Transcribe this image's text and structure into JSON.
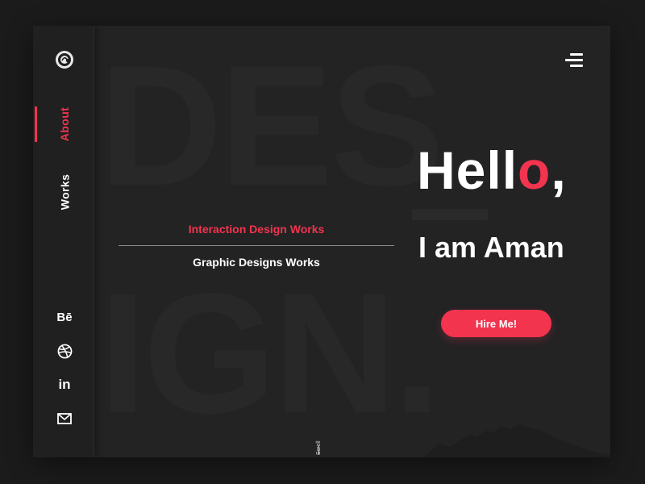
{
  "sidebar": {
    "logo_icon": "avatar-logo-icon",
    "nav": [
      {
        "label": "About",
        "active": true
      },
      {
        "label": "Works",
        "active": false
      }
    ],
    "social": [
      {
        "icon": "behance-icon",
        "label": "Bē"
      },
      {
        "icon": "dribbble-icon"
      },
      {
        "icon": "linkedin-icon",
        "label": "in"
      },
      {
        "icon": "mail-icon"
      }
    ]
  },
  "background_text": {
    "line1": "DES",
    "line2": "IGN."
  },
  "menu_icon": "hamburger-menu-icon",
  "hero": {
    "greeting_main": "Hell",
    "greeting_o": "o",
    "greeting_comma": ",",
    "intro": "I am Aman",
    "cta": "Hire Me!"
  },
  "works": {
    "items": [
      "Interaction Design Works",
      "Graphic Designs Works"
    ]
  },
  "scroll_label": "Scroll",
  "colors": {
    "accent": "#f2344f",
    "background": "#232324",
    "sidebar": "#202021",
    "text": "#ffffff"
  }
}
